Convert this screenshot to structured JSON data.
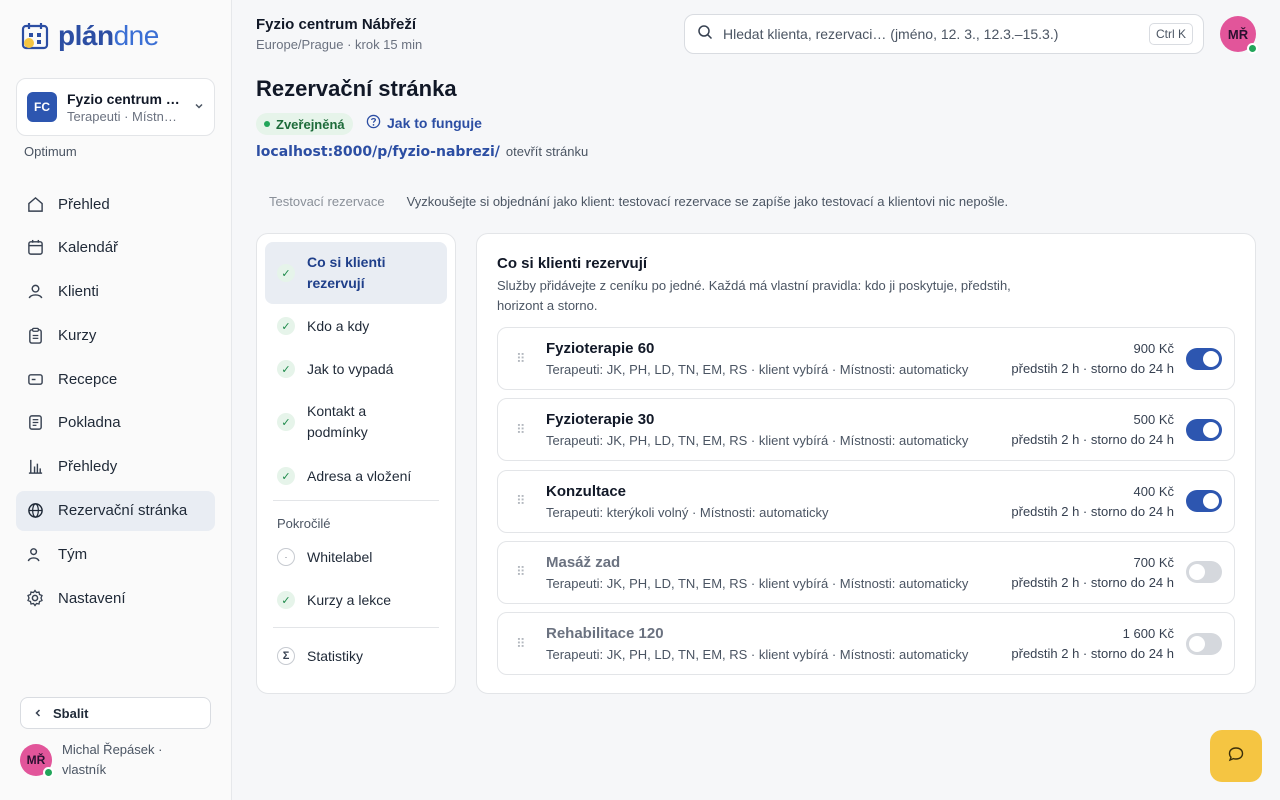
{
  "brand": {
    "logo_strong": "plán",
    "logo_light": "dne"
  },
  "org": {
    "badge": "FC",
    "name": "Fyzio centrum Nábřeží",
    "sub": "Terapeuti · Místnosti",
    "plan": "Optimum"
  },
  "nav": {
    "items": [
      {
        "label": "Přehled",
        "icon": "home-icon"
      },
      {
        "label": "Kalendář",
        "icon": "calendar-icon"
      },
      {
        "label": "Klienti",
        "icon": "user-icon"
      },
      {
        "label": "Kurzy",
        "icon": "clipboard-icon"
      },
      {
        "label": "Recepce",
        "icon": "card-icon"
      },
      {
        "label": "Pokladna",
        "icon": "receipt-icon"
      },
      {
        "label": "Přehledy",
        "icon": "bar-chart-icon"
      },
      {
        "label": "Rezervační stránka",
        "icon": "globe-icon",
        "active": true
      },
      {
        "label": "Tým",
        "icon": "team-icon"
      },
      {
        "label": "Nastavení",
        "icon": "gear-icon"
      }
    ],
    "collapse_label": "Sbalit"
  },
  "user": {
    "initials": "MŘ",
    "name": "Michal Řepásek · vlastník"
  },
  "header": {
    "title": "Fyzio centrum Nábřeží",
    "sub": "Europe/Prague · krok 15 min",
    "search_placeholder": "Hledat klienta, rezervaci… (jméno, 12. 3., 12.3.–15.3.)",
    "shortcut": "Ctrl K",
    "avatar": "MŘ"
  },
  "page": {
    "title": "Rezervační stránka",
    "status": "Zveřejněná",
    "howto": "Jak to funguje",
    "url": "localhost:8000/p/fyzio-nabrezi/",
    "open": "otevřít stránku",
    "test_tab": "Testovací rezervace",
    "test_desc": "Vyzkoušejte si objednání jako klient: testovací rezervace se zapíše jako testovací a klientovi nic nepošle."
  },
  "steps": {
    "main": [
      {
        "label": "Co si klienti rezervují",
        "active": true
      },
      {
        "label": "Kdo a kdy"
      },
      {
        "label": "Jak to vypadá"
      },
      {
        "label": "Kontakt a podmínky"
      },
      {
        "label": "Adresa a vložení"
      }
    ],
    "advanced_label": "Pokročilé",
    "advanced": [
      {
        "label": "Whitelabel",
        "done": false
      },
      {
        "label": "Kurzy a lekce",
        "done": true
      }
    ],
    "stats": "Statistiky"
  },
  "services": {
    "title": "Co si klienti rezervují",
    "desc": "Služby přidávejte z ceníku po jedné. Každá má vlastní pravidla: kdo ji poskytuje, předstih, horizont a storno.",
    "items": [
      {
        "name": "Fyzioterapie 60",
        "meta": "Terapeuti: JK, PH, LD, TN, EM, RS · klient vybírá · Místnosti: automaticky",
        "price": "900 Kč",
        "rules": "předstih 2 h · storno do 24 h",
        "enabled": true
      },
      {
        "name": "Fyzioterapie 30",
        "meta": "Terapeuti: JK, PH, LD, TN, EM, RS · klient vybírá · Místnosti: automaticky",
        "price": "500 Kč",
        "rules": "předstih 2 h · storno do 24 h",
        "enabled": true
      },
      {
        "name": "Konzultace",
        "meta": "Terapeuti: kterýkoli volný · Místnosti: automaticky",
        "price": "400 Kč",
        "rules": "předstih 2 h · storno do 24 h",
        "enabled": true
      },
      {
        "name": "Masáž zad",
        "meta": "Terapeuti: JK, PH, LD, TN, EM, RS · klient vybírá · Místnosti: automaticky",
        "price": "700 Kč",
        "rules": "předstih 2 h · storno do 24 h",
        "enabled": false
      },
      {
        "name": "Rehabilitace 120",
        "meta": "Terapeuti: JK, PH, LD, TN, EM, RS · klient vybírá · Místnosti: automaticky",
        "price": "1 600 Kč",
        "rules": "předstih 2 h · storno do 24 h",
        "enabled": false
      }
    ]
  },
  "colors": {
    "accent": "#2d56b0",
    "brand": "#2c4ea3",
    "success": "#22a55a",
    "fab": "#f5c542"
  }
}
